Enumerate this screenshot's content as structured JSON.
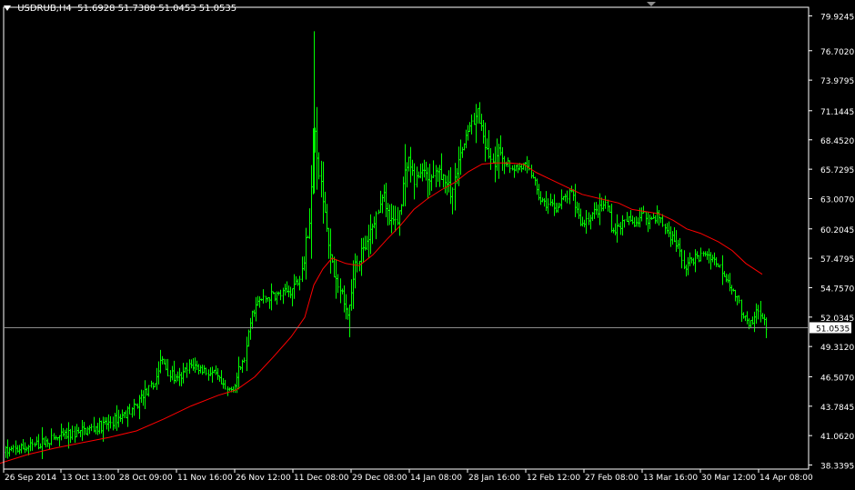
{
  "header": {
    "symbol_tf": "USDRUB,H4",
    "open": "51.6928",
    "high": "51.7388",
    "low": "51.0453",
    "close": "51.0535"
  },
  "colors": {
    "background": "#000000",
    "bars": "#00ff00",
    "ma": "#ff0000",
    "grid_text": "#ffffff",
    "price_line": "#8c8c8c"
  },
  "chart_data": {
    "type": "bar",
    "ohlc_style": true,
    "ylim": [
      38.3395,
      79.9
    ],
    "y_ticks": [
      "79.9245",
      "76.7020",
      "73.9795",
      "71.1445",
      "68.4520",
      "65.7295",
      "63.0070",
      "60.2045",
      "57.4795",
      "54.7570",
      "52.0345",
      "49.3120",
      "46.5070",
      "43.7845",
      "41.0620",
      "38.3395"
    ],
    "x_ticks": [
      "26 Sep 2014",
      "13 Oct 13:00",
      "28 Oct 09:00",
      "11 Nov 16:00",
      "26 Nov 12:00",
      "11 Dec 08:00",
      "29 Dec 08:00",
      "14 Jan 08:00",
      "28 Jan 16:00",
      "12 Feb 12:00",
      "27 Feb 08:00",
      "13 Mar 16:00",
      "30 Mar 12:00",
      "14 Apr 08:00"
    ],
    "last_price": "51.0535",
    "series": [
      {
        "type": "close_path",
        "points": [
          [
            0,
            39.5
          ],
          [
            20,
            39.8
          ],
          [
            40,
            40.2
          ],
          [
            60,
            40.8
          ],
          [
            80,
            41.2
          ],
          [
            100,
            41.7
          ],
          [
            120,
            42.2
          ],
          [
            140,
            43.2
          ],
          [
            150,
            43.7
          ],
          [
            155,
            44.8
          ],
          [
            165,
            45.3
          ],
          [
            172,
            46.5
          ],
          [
            178,
            48.1
          ],
          [
            185,
            46.8
          ],
          [
            195,
            46.1
          ],
          [
            210,
            47.6
          ],
          [
            225,
            47.1
          ],
          [
            238,
            46.5
          ],
          [
            248,
            45.1
          ],
          [
            256,
            45.5
          ],
          [
            262,
            46.8
          ],
          [
            270,
            48.7
          ],
          [
            278,
            52.6
          ],
          [
            285,
            53.5
          ],
          [
            292,
            53.8
          ],
          [
            300,
            54.1
          ],
          [
            310,
            54.1
          ],
          [
            320,
            54.6
          ],
          [
            328,
            55.6
          ],
          [
            334,
            57.5
          ],
          [
            340,
            61.0
          ],
          [
            344,
            70.5
          ],
          [
            348,
            67.5
          ],
          [
            352,
            64.5
          ],
          [
            358,
            61.5
          ],
          [
            362,
            58.0
          ],
          [
            368,
            55.5
          ],
          [
            376,
            54.0
          ],
          [
            382,
            52.3
          ],
          [
            390,
            56.5
          ],
          [
            398,
            58.5
          ],
          [
            406,
            59.5
          ],
          [
            414,
            61.5
          ],
          [
            420,
            63.5
          ],
          [
            428,
            61.5
          ],
          [
            436,
            60.5
          ],
          [
            442,
            63.5
          ],
          [
            448,
            66.5
          ],
          [
            456,
            64.5
          ],
          [
            464,
            65.8
          ],
          [
            472,
            64.8
          ],
          [
            480,
            65.5
          ],
          [
            488,
            65.0
          ],
          [
            496,
            63.5
          ],
          [
            504,
            66.5
          ],
          [
            512,
            68.8
          ],
          [
            518,
            69.5
          ],
          [
            524,
            71.2
          ],
          [
            530,
            69.0
          ],
          [
            536,
            67.0
          ],
          [
            542,
            66.0
          ],
          [
            548,
            67.5
          ],
          [
            556,
            66.5
          ],
          [
            566,
            65.8
          ],
          [
            576,
            66.0
          ],
          [
            586,
            65.0
          ],
          [
            590,
            63.5
          ],
          [
            596,
            62.5
          ],
          [
            604,
            62.5
          ],
          [
            612,
            62.2
          ],
          [
            620,
            63.0
          ],
          [
            628,
            63.5
          ],
          [
            634,
            62.0
          ],
          [
            640,
            60.5
          ],
          [
            648,
            61.5
          ],
          [
            656,
            61.8
          ],
          [
            666,
            62.5
          ],
          [
            674,
            60.0
          ],
          [
            682,
            60.5
          ],
          [
            690,
            61.0
          ],
          [
            698,
            60.8
          ],
          [
            706,
            61.5
          ],
          [
            714,
            61.0
          ],
          [
            722,
            61.5
          ],
          [
            730,
            60.5
          ],
          [
            738,
            59.5
          ],
          [
            746,
            58.5
          ],
          [
            752,
            56.5
          ],
          [
            760,
            57.5
          ],
          [
            768,
            57.5
          ],
          [
            776,
            58.0
          ],
          [
            784,
            57.5
          ],
          [
            792,
            56.5
          ],
          [
            800,
            55.5
          ],
          [
            808,
            54.0
          ],
          [
            816,
            52.5
          ],
          [
            822,
            51.0
          ],
          [
            828,
            51.5
          ],
          [
            834,
            53.0
          ],
          [
            838,
            52.0
          ],
          [
            842,
            51.0535
          ]
        ]
      },
      {
        "type": "moving_average",
        "points": [
          [
            0,
            38.5
          ],
          [
            30,
            39.3
          ],
          [
            60,
            39.9
          ],
          [
            90,
            40.4
          ],
          [
            120,
            40.9
          ],
          [
            150,
            41.5
          ],
          [
            180,
            42.6
          ],
          [
            210,
            43.8
          ],
          [
            240,
            44.8
          ],
          [
            260,
            45.3
          ],
          [
            280,
            46.5
          ],
          [
            300,
            48.3
          ],
          [
            320,
            50.2
          ],
          [
            335,
            52.0
          ],
          [
            345,
            55.0
          ],
          [
            355,
            56.5
          ],
          [
            365,
            57.5
          ],
          [
            380,
            57.0
          ],
          [
            395,
            56.8
          ],
          [
            410,
            57.8
          ],
          [
            425,
            59.2
          ],
          [
            440,
            60.5
          ],
          [
            455,
            62.0
          ],
          [
            470,
            63.0
          ],
          [
            485,
            63.8
          ],
          [
            500,
            64.5
          ],
          [
            515,
            65.5
          ],
          [
            530,
            66.2
          ],
          [
            545,
            66.3
          ],
          [
            560,
            66.3
          ],
          [
            575,
            66.2
          ],
          [
            590,
            65.4
          ],
          [
            605,
            64.8
          ],
          [
            620,
            64.2
          ],
          [
            640,
            63.4
          ],
          [
            660,
            63.0
          ],
          [
            680,
            62.6
          ],
          [
            695,
            62.0
          ],
          [
            710,
            61.8
          ],
          [
            725,
            61.6
          ],
          [
            740,
            61.0
          ],
          [
            755,
            60.2
          ],
          [
            770,
            59.8
          ],
          [
            790,
            59.0
          ],
          [
            805,
            58.2
          ],
          [
            820,
            57.0
          ],
          [
            838,
            56.0
          ]
        ]
      }
    ]
  }
}
